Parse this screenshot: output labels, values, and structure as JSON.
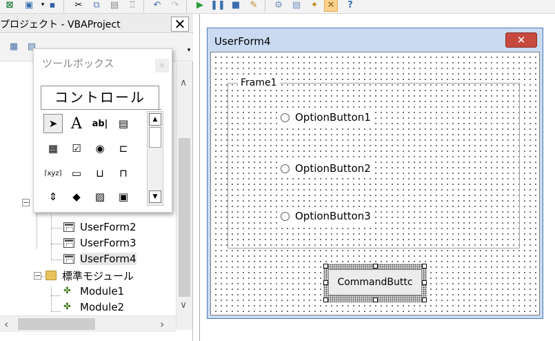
{
  "toolbar": {
    "icons": [
      "excel-icon",
      "insert-icon",
      "save-icon",
      "cut-icon",
      "copy-icon",
      "paste-icon",
      "find-icon",
      "undo-icon",
      "redo-icon",
      "run-icon",
      "break-icon",
      "reset-icon",
      "design-mode-icon",
      "project-explorer-icon",
      "properties-icon",
      "object-browser-icon",
      "toolbox-icon",
      "help-icon"
    ]
  },
  "project": {
    "title": "プロジェクト - VBAProject",
    "close_label": "✕",
    "tree": {
      "forms": [
        "UserForm2",
        "UserForm3",
        "UserForm4"
      ],
      "modules_folder": "標準モジュール",
      "modules": [
        "Module1",
        "Module2"
      ]
    }
  },
  "toolbox": {
    "title": "ツールボックス",
    "tab": "コントロール",
    "tools": [
      {
        "icon": "pointer-icon",
        "glyph": "➤"
      },
      {
        "icon": "label-icon",
        "glyph": "A"
      },
      {
        "icon": "textbox-icon",
        "glyph": "ab|"
      },
      {
        "icon": "combobox-icon",
        "glyph": "▤"
      },
      {
        "icon": "listbox-icon",
        "glyph": "▦"
      },
      {
        "icon": "checkbox-icon",
        "glyph": "☑"
      },
      {
        "icon": "optionbutton-icon",
        "glyph": "◉"
      },
      {
        "icon": "togglebutton-icon",
        "glyph": "⊏"
      },
      {
        "icon": "frame-icon",
        "glyph": "⌈xyz⌉"
      },
      {
        "icon": "commandbutton-icon",
        "glyph": "▭"
      },
      {
        "icon": "tabstrip-icon",
        "glyph": "⊔"
      },
      {
        "icon": "multipage-icon",
        "glyph": "⊓"
      },
      {
        "icon": "scrollbar-icon",
        "glyph": "⇕"
      },
      {
        "icon": "spinbutton-icon",
        "glyph": "◆"
      },
      {
        "icon": "image-icon",
        "glyph": "▨"
      },
      {
        "icon": "refedit-icon",
        "glyph": "▣"
      }
    ]
  },
  "userform": {
    "title": "UserForm4",
    "close_label": "✕",
    "frame_caption": "Frame1",
    "options": [
      "OptionButton1",
      "OptionButton2",
      "OptionButton3"
    ],
    "command_button": "CommandButtc"
  },
  "colors": {
    "title_bar": "#c9daf1",
    "close_button": "#c74a3f",
    "selected_tool": "#fcd28c"
  }
}
